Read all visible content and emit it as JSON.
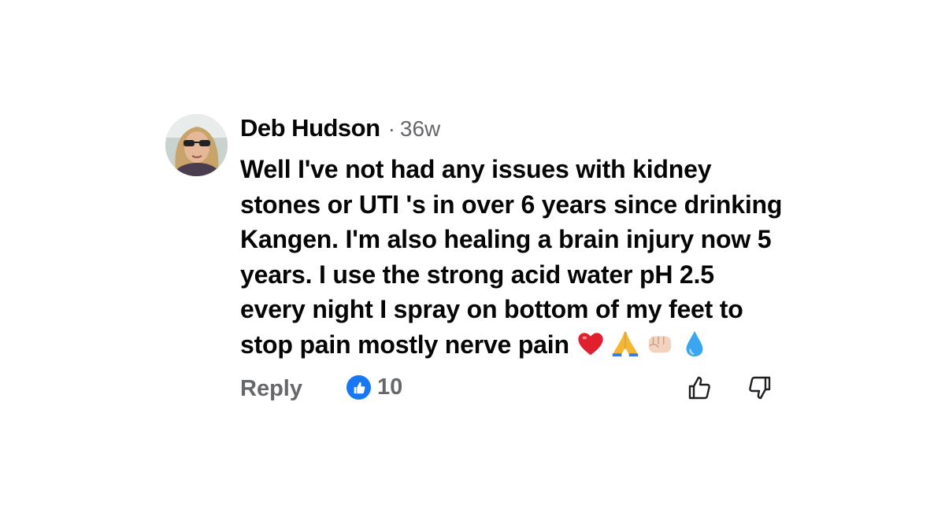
{
  "comment": {
    "author": "Deb Hudson",
    "separator": "·",
    "age": "36w",
    "text": "Well I've not had any issues with kidney stones or UTI 's in over 6 years since drinking Kangen. I'm also healing a brain injury now 5 years. I use the strong acid water pH 2.5 every night I spray on bottom of my feet to stop pain mostly nerve pain",
    "emojis": [
      "heart-emoji",
      "folded-hands-emoji",
      "fist-emoji",
      "droplet-emoji"
    ]
  },
  "actions": {
    "reply_label": "Reply",
    "reaction_count": "10",
    "reaction_icon": "like-reaction-icon",
    "like_icon": "thumbs-up-icon",
    "dislike_icon": "thumbs-down-icon"
  },
  "colors": {
    "text": "#050505",
    "secondary": "#65676b",
    "like_blue": "#1877f2",
    "heart_red": "#e0202e"
  }
}
